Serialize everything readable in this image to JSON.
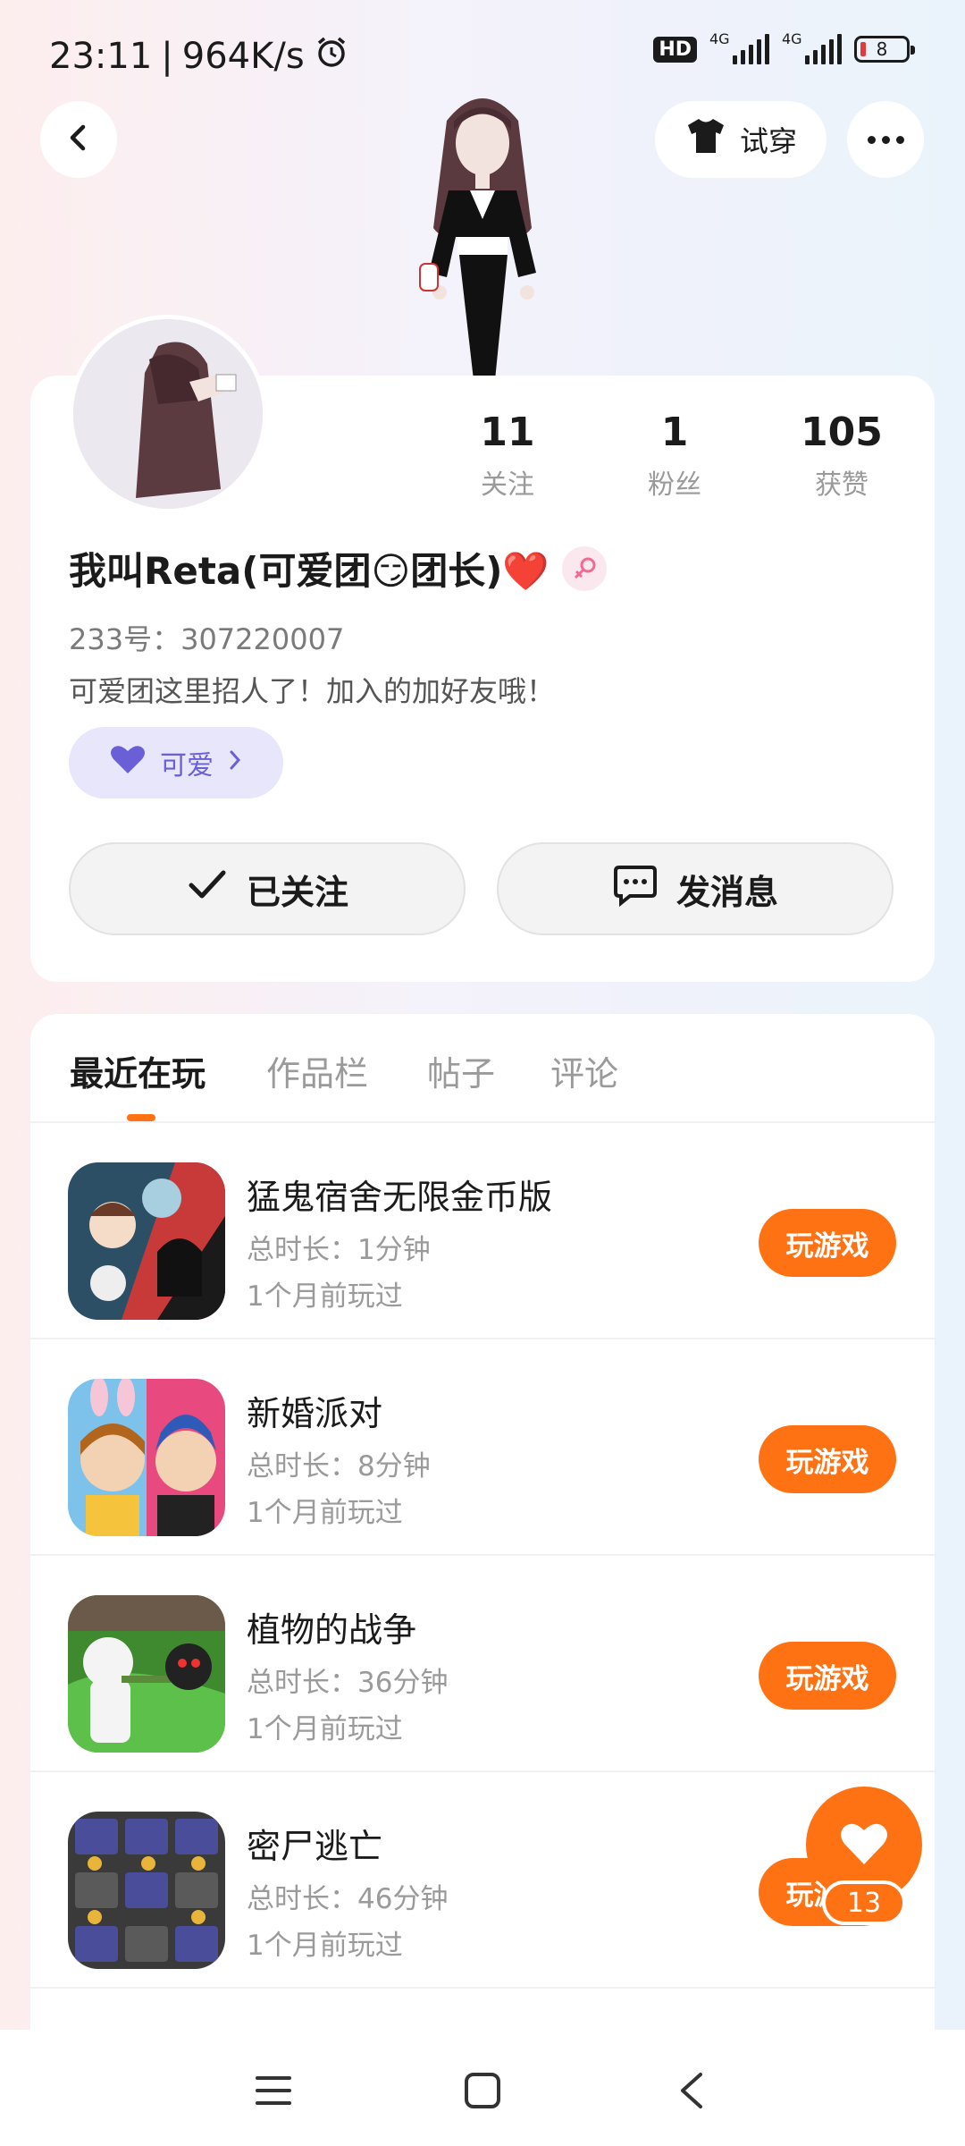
{
  "status_bar": {
    "time": "23:11",
    "network_speed": "964K/s",
    "hd_label": "HD",
    "sim1_label": "4G",
    "sim2_label": "4G",
    "battery": "8",
    "icons": [
      "alarm-icon",
      "hd-icon",
      "signal-icon",
      "signal-icon",
      "battery-icon"
    ]
  },
  "header": {
    "back_icon": "chevron-left-icon",
    "try_on_label": "试穿",
    "try_on_icon": "tshirt-icon",
    "more_icon": "more-dots-icon"
  },
  "profile": {
    "stats": [
      {
        "value": "11",
        "label": "关注"
      },
      {
        "value": "1",
        "label": "粉丝"
      },
      {
        "value": "105",
        "label": "获赞"
      }
    ],
    "name": "我叫Reta(可爱团😏团长)❤️",
    "gender_icon": "female-icon",
    "id_text": "233号：307220007",
    "bio": "可爱团这里招人了！加入的加好友哦！",
    "tag": {
      "label": "可爱",
      "icon": "heart-icon"
    },
    "follow_button": "已关注",
    "message_button": "发消息"
  },
  "tabs": [
    {
      "label": "最近在玩",
      "active": true
    },
    {
      "label": "作品栏",
      "active": false
    },
    {
      "label": "帖子",
      "active": false
    },
    {
      "label": "评论",
      "active": false
    }
  ],
  "games": [
    {
      "title": "猛鬼宿舍无限金币版",
      "duration": "总时长：1分钟",
      "last_played": "1个月前玩过",
      "button": "玩游戏"
    },
    {
      "title": "新婚派对",
      "duration": "总时长：8分钟",
      "last_played": "1个月前玩过",
      "button": "玩游戏"
    },
    {
      "title": "植物的战争",
      "duration": "总时长：36分钟",
      "last_played": "1个月前玩过",
      "button": "玩游戏"
    },
    {
      "title": "密尸逃亡",
      "duration": "总时长：46分钟",
      "last_played": "1个月前玩过",
      "button": "玩游戏"
    }
  ],
  "fab": {
    "icon": "heart-icon",
    "count": "13"
  },
  "colors": {
    "accent": "#ff7214",
    "tag_bg": "#e7e6fb",
    "tag_fg": "#6a5fd6"
  },
  "nav_bar": {
    "icons": [
      "menu-icon",
      "home-square-icon",
      "back-triangle-icon"
    ]
  }
}
